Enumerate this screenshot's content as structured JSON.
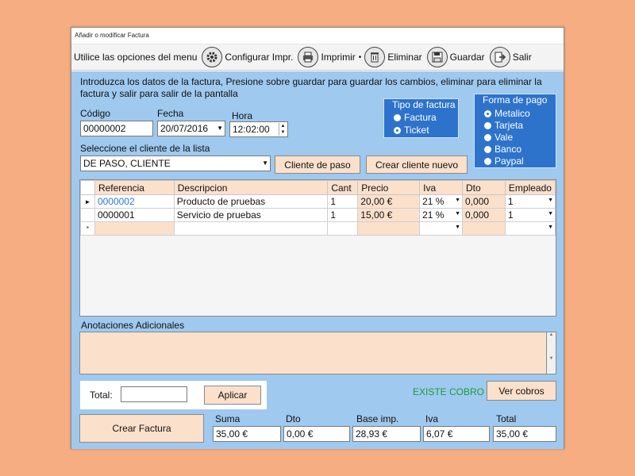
{
  "window": {
    "title": "Añadir o modificar Factura"
  },
  "toolbar": {
    "prompt": "Utilice las opciones del menu",
    "configurar": "Configurar Impr.",
    "imprimir": "Imprimir",
    "eliminar": "Eliminar",
    "guardar": "Guardar",
    "salir": "Salir"
  },
  "intro": "Introduzca los datos de la factura, Presione sobre guardar para guardar los cambios, eliminar para eliminar la factura y salir para salir de la pantalla",
  "form": {
    "codigo_label": "Código",
    "codigo_value": "00000002",
    "fecha_label": "Fecha",
    "fecha_value": "20/07/2016",
    "hora_label": "Hora",
    "hora_value": "12:02:00",
    "cliente_label": "Seleccione el cliente de la lista",
    "cliente_value": "DE PASO, CLIENTE",
    "btn_cliente_paso": "Cliente de paso",
    "btn_crear_cliente": "Crear cliente nuevo"
  },
  "tipo_factura": {
    "title": "Tipo de factura",
    "options": [
      "Factura",
      "Ticket"
    ],
    "selected": "Ticket"
  },
  "forma_pago": {
    "title": "Forma de pago",
    "options": [
      "Metalico",
      "Tarjeta",
      "Vale",
      "Banco",
      "Paypal"
    ],
    "selected": "Metalico"
  },
  "grid": {
    "columns": [
      "Referencia",
      "Descripcion",
      "Cant",
      "Precio",
      "Iva",
      "Dto",
      "Empleado"
    ],
    "rows": [
      {
        "marker": "►",
        "ref": "0000002",
        "desc": "Producto de pruebas",
        "cant": "1",
        "precio": "20,00 €",
        "iva": "21 %",
        "dto": "0,000",
        "empleado": "1"
      },
      {
        "marker": "",
        "ref": "0000001",
        "desc": "Servicio de pruebas",
        "cant": "1",
        "precio": "15,00 €",
        "iva": "21 %",
        "dto": "0,000",
        "empleado": "1"
      }
    ],
    "new_row_marker": "*"
  },
  "notes": {
    "label": "Anotaciones Adicionales"
  },
  "total": {
    "label": "Total:",
    "button": "Aplicar"
  },
  "cobro": {
    "status": "EXISTE COBRO",
    "button": "Ver cobros"
  },
  "footer": {
    "crear_factura": "Crear Factura",
    "suma_label": "Suma",
    "suma_value": "35,00 €",
    "dto_label": "Dto",
    "dto_value": "0,00 €",
    "base_label": "Base imp.",
    "base_value": "28,93 €",
    "iva_label": "Iva",
    "iva_value": "6,07 €",
    "total_label": "Total",
    "total_value": "35,00 €"
  },
  "colors": {
    "background": "#f6ad82",
    "client_area": "#9fc9ef",
    "group_box": "#2d73cc",
    "peach": "#fbe0cc",
    "status_green": "#1f9a3a",
    "selected_text": "#2a7ad6"
  },
  "icons": [
    "gear-icon",
    "printer-icon",
    "trash-icon",
    "floppy-disk-icon",
    "exit-icon"
  ]
}
